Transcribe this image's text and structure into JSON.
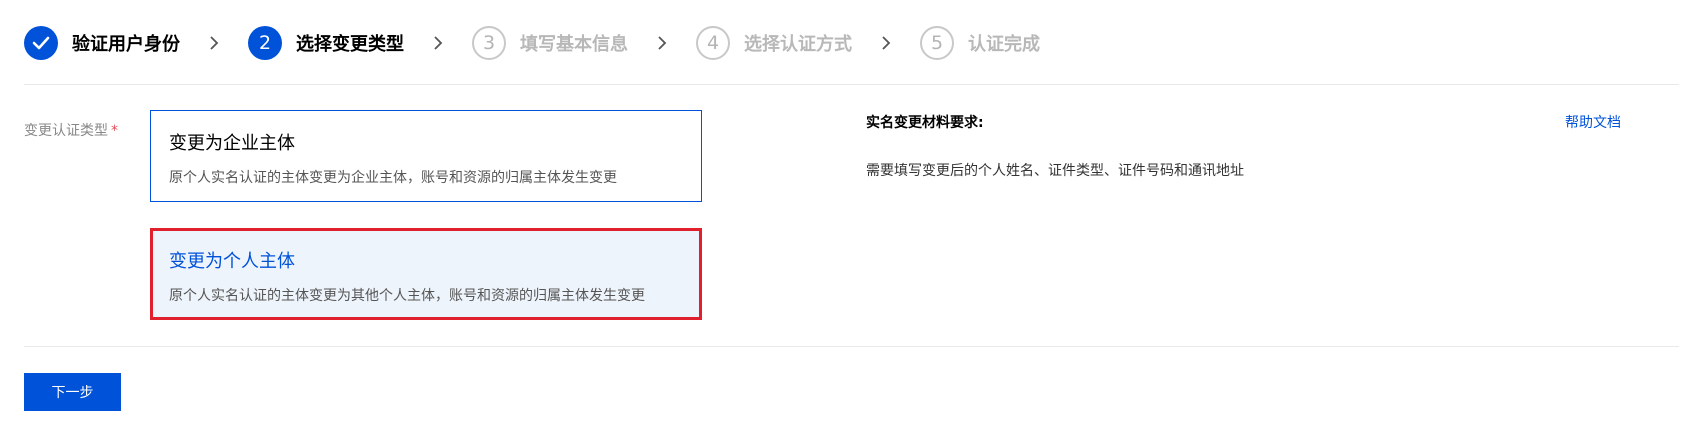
{
  "steps": [
    {
      "number": "",
      "label": "验证用户身份",
      "state": "done"
    },
    {
      "number": "2",
      "label": "选择变更类型",
      "state": "active"
    },
    {
      "number": "3",
      "label": "填写基本信息",
      "state": "pending"
    },
    {
      "number": "4",
      "label": "选择认证方式",
      "state": "pending"
    },
    {
      "number": "5",
      "label": "认证完成",
      "state": "pending"
    }
  ],
  "form": {
    "field_label": "变更认证类型",
    "required_mark": "*",
    "options": [
      {
        "title": "变更为企业主体",
        "description": "原个人实名认证的主体变更为企业主体，账号和资源的归属主体发生变更",
        "selected": false
      },
      {
        "title": "变更为个人主体",
        "description": "原个人实名认证的主体变更为其他个人主体，账号和资源的归属主体发生变更",
        "selected": true
      }
    ]
  },
  "requirements": {
    "title": "实名变更材料要求:",
    "text": "需要填写变更后的个人姓名、证件类型、证件号码和通讯地址",
    "help_link": "帮助文档"
  },
  "footer": {
    "next_button": "下一步"
  },
  "colors": {
    "primary": "#0052d9",
    "highlight_border": "#e0202d",
    "selected_bg": "#eef4fc",
    "pending": "#b8b8b8"
  },
  "icons": {
    "done_step": "checkmark-icon",
    "separator": "chevron-right-icon"
  }
}
